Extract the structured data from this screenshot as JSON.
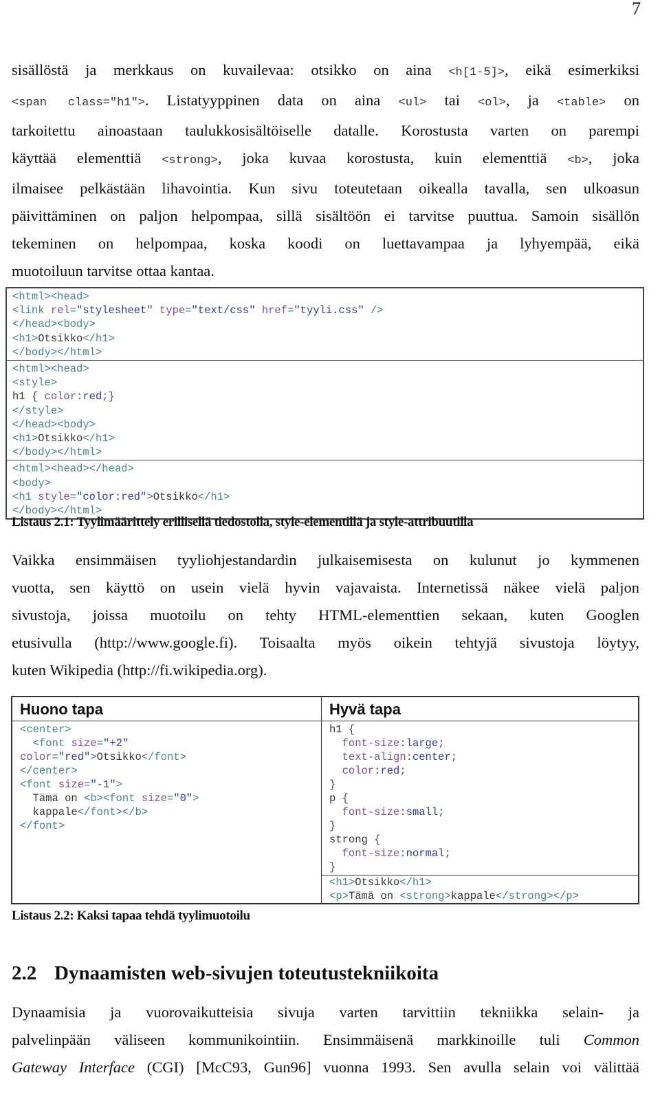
{
  "page_number": "7",
  "paragraph1": {
    "lines": [
      [
        [
          "t",
          "sisällöstä ja merkkaus on kuvailevaa: otsikko on aina "
        ],
        [
          "c",
          "<h[1-5]>"
        ],
        [
          "t",
          ", eikä esimerkiksi"
        ]
      ],
      [
        [
          "c",
          "<span class=\"h1\">"
        ],
        [
          "t",
          ". Listatyyppinen data on aina "
        ],
        [
          "c",
          "<ul>"
        ],
        [
          "t",
          " tai "
        ],
        [
          "c",
          "<ol>"
        ],
        [
          "t",
          ", ja "
        ],
        [
          "c",
          "<table>"
        ],
        [
          "t",
          " on"
        ]
      ],
      [
        [
          "t",
          "tarkoitettu ainoastaan taulukkosisältöiselle datalle. Korostusta varten on parempi"
        ]
      ],
      [
        [
          "t",
          "käyttää elementtiä "
        ],
        [
          "c",
          "<strong>"
        ],
        [
          "t",
          ", joka kuvaa korostusta, kuin elementtiä "
        ],
        [
          "c",
          "<b>"
        ],
        [
          "t",
          ", joka"
        ]
      ],
      [
        [
          "t",
          "ilmaisee pelkästään lihavointia. Kun sivu toteutetaan oikealla tavalla, sen ulkoasun"
        ]
      ],
      [
        [
          "t",
          "päivittäminen on paljon helpompaa, sillä sisältöön ei tarvitse puuttua. Samoin sisällön"
        ]
      ],
      [
        [
          "t",
          "tekeminen on helpompaa, koska koodi on luettavampaa ja lyhyempää, eikä"
        ]
      ],
      [
        [
          "t",
          "muotoiluun tarvitse ottaa kantaa."
        ]
      ]
    ]
  },
  "listing1": {
    "sections": [
      [
        [
          [
            "br",
            "<"
          ],
          [
            "tag",
            "html"
          ],
          [
            "br",
            "><"
          ],
          [
            "tag",
            "head"
          ],
          [
            "br",
            ">"
          ]
        ],
        [
          [
            "br",
            "<"
          ],
          [
            "tag",
            "link "
          ],
          [
            "attr",
            "rel"
          ],
          [
            "br",
            "="
          ],
          [
            "val",
            "\"stylesheet\" "
          ],
          [
            "attr",
            "type"
          ],
          [
            "br",
            "="
          ],
          [
            "val",
            "\"text/css\" "
          ],
          [
            "attr",
            "href"
          ],
          [
            "br",
            "="
          ],
          [
            "val",
            "\"tyyli.css\" "
          ],
          [
            "br",
            "/>"
          ]
        ],
        [
          [
            "br",
            "</"
          ],
          [
            "tag",
            "head"
          ],
          [
            "br",
            "><"
          ],
          [
            "tag",
            "body"
          ],
          [
            "br",
            ">"
          ]
        ],
        [
          [
            "br",
            "<"
          ],
          [
            "tag",
            "h1"
          ],
          [
            "br",
            ">"
          ],
          [
            "txt",
            "Otsikko"
          ],
          [
            "br",
            "</"
          ],
          [
            "tag",
            "h1"
          ],
          [
            "br",
            ">"
          ]
        ],
        [
          [
            "br",
            "</"
          ],
          [
            "tag",
            "body"
          ],
          [
            "br",
            "></"
          ],
          [
            "tag",
            "html"
          ],
          [
            "br",
            ">"
          ]
        ]
      ],
      [
        [
          [
            "br",
            "<"
          ],
          [
            "tag",
            "html"
          ],
          [
            "br",
            "><"
          ],
          [
            "tag",
            "head"
          ],
          [
            "br",
            ">"
          ]
        ],
        [
          [
            "br",
            "<"
          ],
          [
            "tag",
            "style"
          ],
          [
            "br",
            ">"
          ]
        ],
        [
          [
            "sel",
            "h1 "
          ],
          [
            "punc",
            "{ "
          ],
          [
            "prop",
            "color"
          ],
          [
            "punc",
            ":"
          ],
          [
            "val",
            "red"
          ],
          [
            "punc",
            ";}"
          ]
        ],
        [
          [
            "br",
            "</"
          ],
          [
            "tag",
            "style"
          ],
          [
            "br",
            ">"
          ]
        ],
        [
          [
            "br",
            "</"
          ],
          [
            "tag",
            "head"
          ],
          [
            "br",
            "><"
          ],
          [
            "tag",
            "body"
          ],
          [
            "br",
            ">"
          ]
        ],
        [
          [
            "br",
            "<"
          ],
          [
            "tag",
            "h1"
          ],
          [
            "br",
            ">"
          ],
          [
            "txt",
            "Otsikko"
          ],
          [
            "br",
            "</"
          ],
          [
            "tag",
            "h1"
          ],
          [
            "br",
            ">"
          ]
        ],
        [
          [
            "br",
            "</"
          ],
          [
            "tag",
            "body"
          ],
          [
            "br",
            "></"
          ],
          [
            "tag",
            "html"
          ],
          [
            "br",
            ">"
          ]
        ]
      ],
      [
        [
          [
            "br",
            "<"
          ],
          [
            "tag",
            "html"
          ],
          [
            "br",
            "><"
          ],
          [
            "tag",
            "head"
          ],
          [
            "br",
            "></"
          ],
          [
            "tag",
            "head"
          ],
          [
            "br",
            ">"
          ]
        ],
        [
          [
            "br",
            "<"
          ],
          [
            "tag",
            "body"
          ],
          [
            "br",
            ">"
          ]
        ],
        [
          [
            "br",
            "<"
          ],
          [
            "tag",
            "h1 "
          ],
          [
            "attr",
            "style"
          ],
          [
            "br",
            "="
          ],
          [
            "val",
            "\"color:red\""
          ],
          [
            "br",
            ">"
          ],
          [
            "txt",
            "Otsikko"
          ],
          [
            "br",
            "</"
          ],
          [
            "tag",
            "h1"
          ],
          [
            "br",
            ">"
          ]
        ],
        [
          [
            "br",
            "</"
          ],
          [
            "tag",
            "body"
          ],
          [
            "br",
            "></"
          ],
          [
            "tag",
            "html"
          ],
          [
            "br",
            ">"
          ]
        ]
      ]
    ],
    "caption": "Listaus 2.1: Tyylimäärittely erillisellä tiedostolla, style-elementillä ja style-attribuutilla"
  },
  "paragraph2": {
    "lines": [
      [
        [
          "t",
          "Vaikka ensimmäisen tyyliohjestandardin julkaisemisesta on kulunut jo kymmenen"
        ]
      ],
      [
        [
          "t",
          "vuotta, sen käyttö on usein vielä hyvin vajavaista. Internetissä näkee vielä paljon"
        ]
      ],
      [
        [
          "t",
          "sivustoja, joissa muotoilu on tehty HTML-elementtien sekaan, kuten Googlen"
        ]
      ],
      [
        [
          "t",
          "etusivulla (http://www.google.fi). Toisaalta myös oikein tehtyjä sivustoja löytyy,"
        ]
      ],
      [
        [
          "t",
          "kuten Wikipedia (http://fi.wikipedia.org)."
        ]
      ]
    ]
  },
  "listing2": {
    "bad": {
      "title": "Huono tapa",
      "code": [
        [
          [
            "br",
            "<"
          ],
          [
            "tag",
            "center"
          ],
          [
            "br",
            ">"
          ]
        ],
        [
          [
            "txt",
            "  "
          ],
          [
            "br",
            "<"
          ],
          [
            "tag",
            "font "
          ],
          [
            "attr",
            "size"
          ],
          [
            "br",
            "="
          ],
          [
            "val",
            "\"+2\""
          ]
        ],
        [
          [
            "attr",
            "color"
          ],
          [
            "br",
            "="
          ],
          [
            "val",
            "\"red\""
          ],
          [
            "br",
            ">"
          ],
          [
            "txt",
            "Otsikko"
          ],
          [
            "br",
            "</"
          ],
          [
            "tag",
            "font"
          ],
          [
            "br",
            ">"
          ]
        ],
        [
          [
            "br",
            "</"
          ],
          [
            "tag",
            "center"
          ],
          [
            "br",
            ">"
          ]
        ],
        [
          [
            "br",
            "<"
          ],
          [
            "tag",
            "font "
          ],
          [
            "attr",
            "size"
          ],
          [
            "br",
            "="
          ],
          [
            "val",
            "\"-1\""
          ],
          [
            "br",
            ">"
          ]
        ],
        [
          [
            "txt",
            "  Tämä on "
          ],
          [
            "br",
            "<"
          ],
          [
            "tag",
            "b"
          ],
          [
            "br",
            "><"
          ],
          [
            "tag",
            "font "
          ],
          [
            "attr",
            "size"
          ],
          [
            "br",
            "="
          ],
          [
            "val",
            "\"0\""
          ],
          [
            "br",
            ">"
          ]
        ],
        [
          [
            "txt",
            "  kappale"
          ],
          [
            "br",
            "</"
          ],
          [
            "tag",
            "font"
          ],
          [
            "br",
            "></"
          ],
          [
            "tag",
            "b"
          ],
          [
            "br",
            ">"
          ]
        ],
        [
          [
            "br",
            "</"
          ],
          [
            "tag",
            "font"
          ],
          [
            "br",
            ">"
          ]
        ]
      ]
    },
    "good": {
      "title": "Hyvä tapa",
      "css": [
        [
          [
            "sel",
            "h1 "
          ],
          [
            "punc",
            "{"
          ]
        ],
        [
          [
            "txt",
            "  "
          ],
          [
            "prop",
            "font-size"
          ],
          [
            "punc",
            ":"
          ],
          [
            "val",
            "large"
          ],
          [
            "punc",
            ";"
          ]
        ],
        [
          [
            "txt",
            "  "
          ],
          [
            "prop",
            "text-align"
          ],
          [
            "punc",
            ":"
          ],
          [
            "val",
            "center"
          ],
          [
            "punc",
            ";"
          ]
        ],
        [
          [
            "txt",
            "  "
          ],
          [
            "prop",
            "color"
          ],
          [
            "punc",
            ":"
          ],
          [
            "val",
            "red"
          ],
          [
            "punc",
            ";"
          ]
        ],
        [
          [
            "punc",
            "}"
          ]
        ],
        [
          [
            "sel",
            "p "
          ],
          [
            "punc",
            "{"
          ]
        ],
        [
          [
            "txt",
            "  "
          ],
          [
            "prop",
            "font-size"
          ],
          [
            "punc",
            ":"
          ],
          [
            "val",
            "small"
          ],
          [
            "punc",
            ";"
          ]
        ],
        [
          [
            "punc",
            "}"
          ]
        ],
        [
          [
            "sel",
            "strong "
          ],
          [
            "punc",
            "{"
          ]
        ],
        [
          [
            "txt",
            "  "
          ],
          [
            "prop",
            "font-size"
          ],
          [
            "punc",
            ":"
          ],
          [
            "val",
            "normal"
          ],
          [
            "punc",
            ";"
          ]
        ],
        [
          [
            "punc",
            "}"
          ]
        ]
      ],
      "html": [
        [
          [
            "br",
            "<"
          ],
          [
            "tag",
            "h1"
          ],
          [
            "br",
            ">"
          ],
          [
            "txt",
            "Otsikko"
          ],
          [
            "br",
            "</"
          ],
          [
            "tag",
            "h1"
          ],
          [
            "br",
            ">"
          ]
        ],
        [
          [
            "br",
            "<"
          ],
          [
            "tag",
            "p"
          ],
          [
            "br",
            ">"
          ],
          [
            "txt",
            "Tämä on "
          ],
          [
            "br",
            "<"
          ],
          [
            "tag",
            "strong"
          ],
          [
            "br",
            ">"
          ],
          [
            "txt",
            "kappale"
          ],
          [
            "br",
            "</"
          ],
          [
            "tag",
            "strong"
          ],
          [
            "br",
            "></"
          ],
          [
            "tag",
            "p"
          ],
          [
            "br",
            ">"
          ]
        ]
      ]
    },
    "caption": "Listaus 2.2: Kaksi tapaa tehdä tyylimuotoilu"
  },
  "section": {
    "number": "2.2",
    "title": "Dynaamisten web-sivujen toteutustekniikoita"
  },
  "paragraph3": {
    "lines": [
      [
        [
          "t",
          "Dynaamisia ja vuorovaikutteisia sivuja varten tarvittiin tekniikka selain- ja"
        ]
      ],
      [
        [
          "t",
          "palvelinpään väliseen kommunikointiin. Ensimmäisenä markkinoille tuli "
        ],
        [
          "i",
          "Common"
        ]
      ],
      [
        [
          "i",
          "Gateway Interface"
        ],
        [
          "t",
          " (CGI) [McC93, Gun96] vuonna 1993. Sen avulla selain voi välittää"
        ]
      ]
    ],
    "justify_last": true
  },
  "colors": {
    "bracket": "#3f7f86",
    "tag": "#4a858a",
    "attribute": "#7a4f8c",
    "value": "#2c3c9a",
    "text": "#333333"
  }
}
